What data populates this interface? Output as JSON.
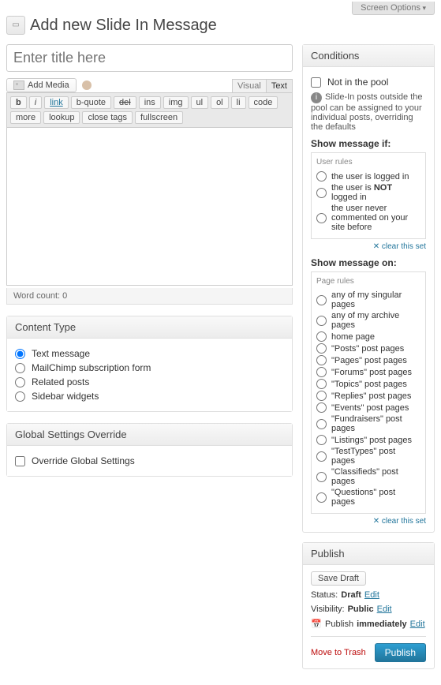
{
  "screen_options_label": "Screen Options",
  "page_title": "Add new Slide In Message",
  "title_placeholder": "Enter title here",
  "add_media_label": "Add Media",
  "tabs": {
    "visual": "Visual",
    "text": "Text"
  },
  "qt": [
    "b",
    "i",
    "link",
    "b-quote",
    "del",
    "ins",
    "img",
    "ul",
    "ol",
    "li",
    "code",
    "more",
    "lookup",
    "close tags",
    "fullscreen"
  ],
  "word_count_label": "Word count:",
  "word_count_value": "0",
  "content_type": {
    "title": "Content Type",
    "options": [
      "Text message",
      "MailChimp subscription form",
      "Related posts",
      "Sidebar widgets"
    ]
  },
  "global_override": {
    "title": "Global Settings Override",
    "checkbox": "Override Global Settings"
  },
  "conditions": {
    "title": "Conditions",
    "not_in_pool": "Not in the pool",
    "info": "Slide-In posts outside the pool can be assigned to your individual posts, overriding the defaults",
    "show_if_label": "Show message if:",
    "user_rules_legend": "User rules",
    "user_rules": [
      "the user is logged in",
      "the user is <b>NOT</b> logged in",
      "the user never commented on your site before"
    ],
    "show_on_label": "Show message on:",
    "page_rules_legend": "Page rules",
    "page_rules": [
      "any of my singular pages",
      "any of my archive pages",
      "home page",
      "\"Posts\" post pages",
      "\"Pages\" post pages",
      "\"Forums\" post pages",
      "\"Topics\" post pages",
      "\"Replies\" post pages",
      "\"Events\" post pages",
      "\"Fundraisers\" post pages",
      "\"Listings\" post pages",
      "\"TestTypes\" post pages",
      "\"Classifieds\" post pages",
      "\"Questions\" post pages"
    ],
    "clear_set": "clear this set"
  },
  "publish": {
    "title": "Publish",
    "save_draft": "Save Draft",
    "status_label": "Status:",
    "status_value": "Draft",
    "visibility_label": "Visibility:",
    "visibility_value": "Public",
    "schedule_prefix": "Publish",
    "schedule_value": "immediately",
    "edit": "Edit",
    "trash": "Move to Trash",
    "publish_btn": "Publish"
  }
}
